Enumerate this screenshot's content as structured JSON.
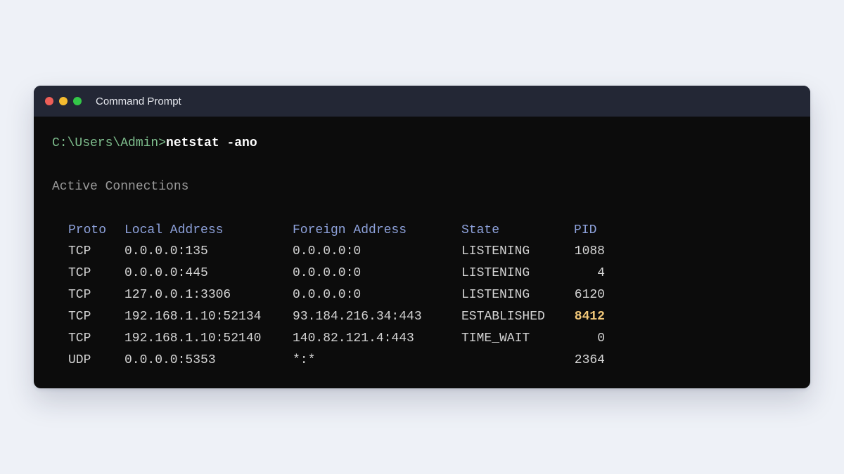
{
  "window": {
    "title": "Command Prompt",
    "controls": {
      "close_color": "#ee5f58",
      "minimize_color": "#f4bb2f",
      "maximize_color": "#33c748"
    }
  },
  "terminal": {
    "prompt": "C:\\Users\\Admin>",
    "command": "netstat -ano",
    "section_heading": "Active Connections",
    "headers": {
      "proto": "Proto",
      "local": "Local Address",
      "foreign": "Foreign Address",
      "state": "State",
      "pid": "PID"
    },
    "rows": [
      {
        "proto": "TCP",
        "local": "0.0.0.0:135",
        "foreign": "0.0.0.0:0",
        "state": "LISTENING",
        "pid": "1088"
      },
      {
        "proto": "TCP",
        "local": "0.0.0.0:445",
        "foreign": "0.0.0.0:0",
        "state": "LISTENING",
        "pid": "4"
      },
      {
        "proto": "TCP",
        "local": "127.0.0.1:3306",
        "foreign": "0.0.0.0:0",
        "state": "LISTENING",
        "pid": "6120"
      },
      {
        "proto": "TCP",
        "local": "192.168.1.10:52134",
        "foreign": "93.184.216.34:443",
        "state": "ESTABLISHED",
        "pid": "8412"
      },
      {
        "proto": "TCP",
        "local": "192.168.1.10:52140",
        "foreign": "140.82.121.4:443",
        "state": "TIME_WAIT",
        "pid": "0"
      },
      {
        "proto": "UDP",
        "local": "0.0.0.0:5353",
        "foreign": "*:*",
        "state": "",
        "pid": "2364"
      }
    ],
    "highlighted_pid_color": "#f2c879"
  }
}
